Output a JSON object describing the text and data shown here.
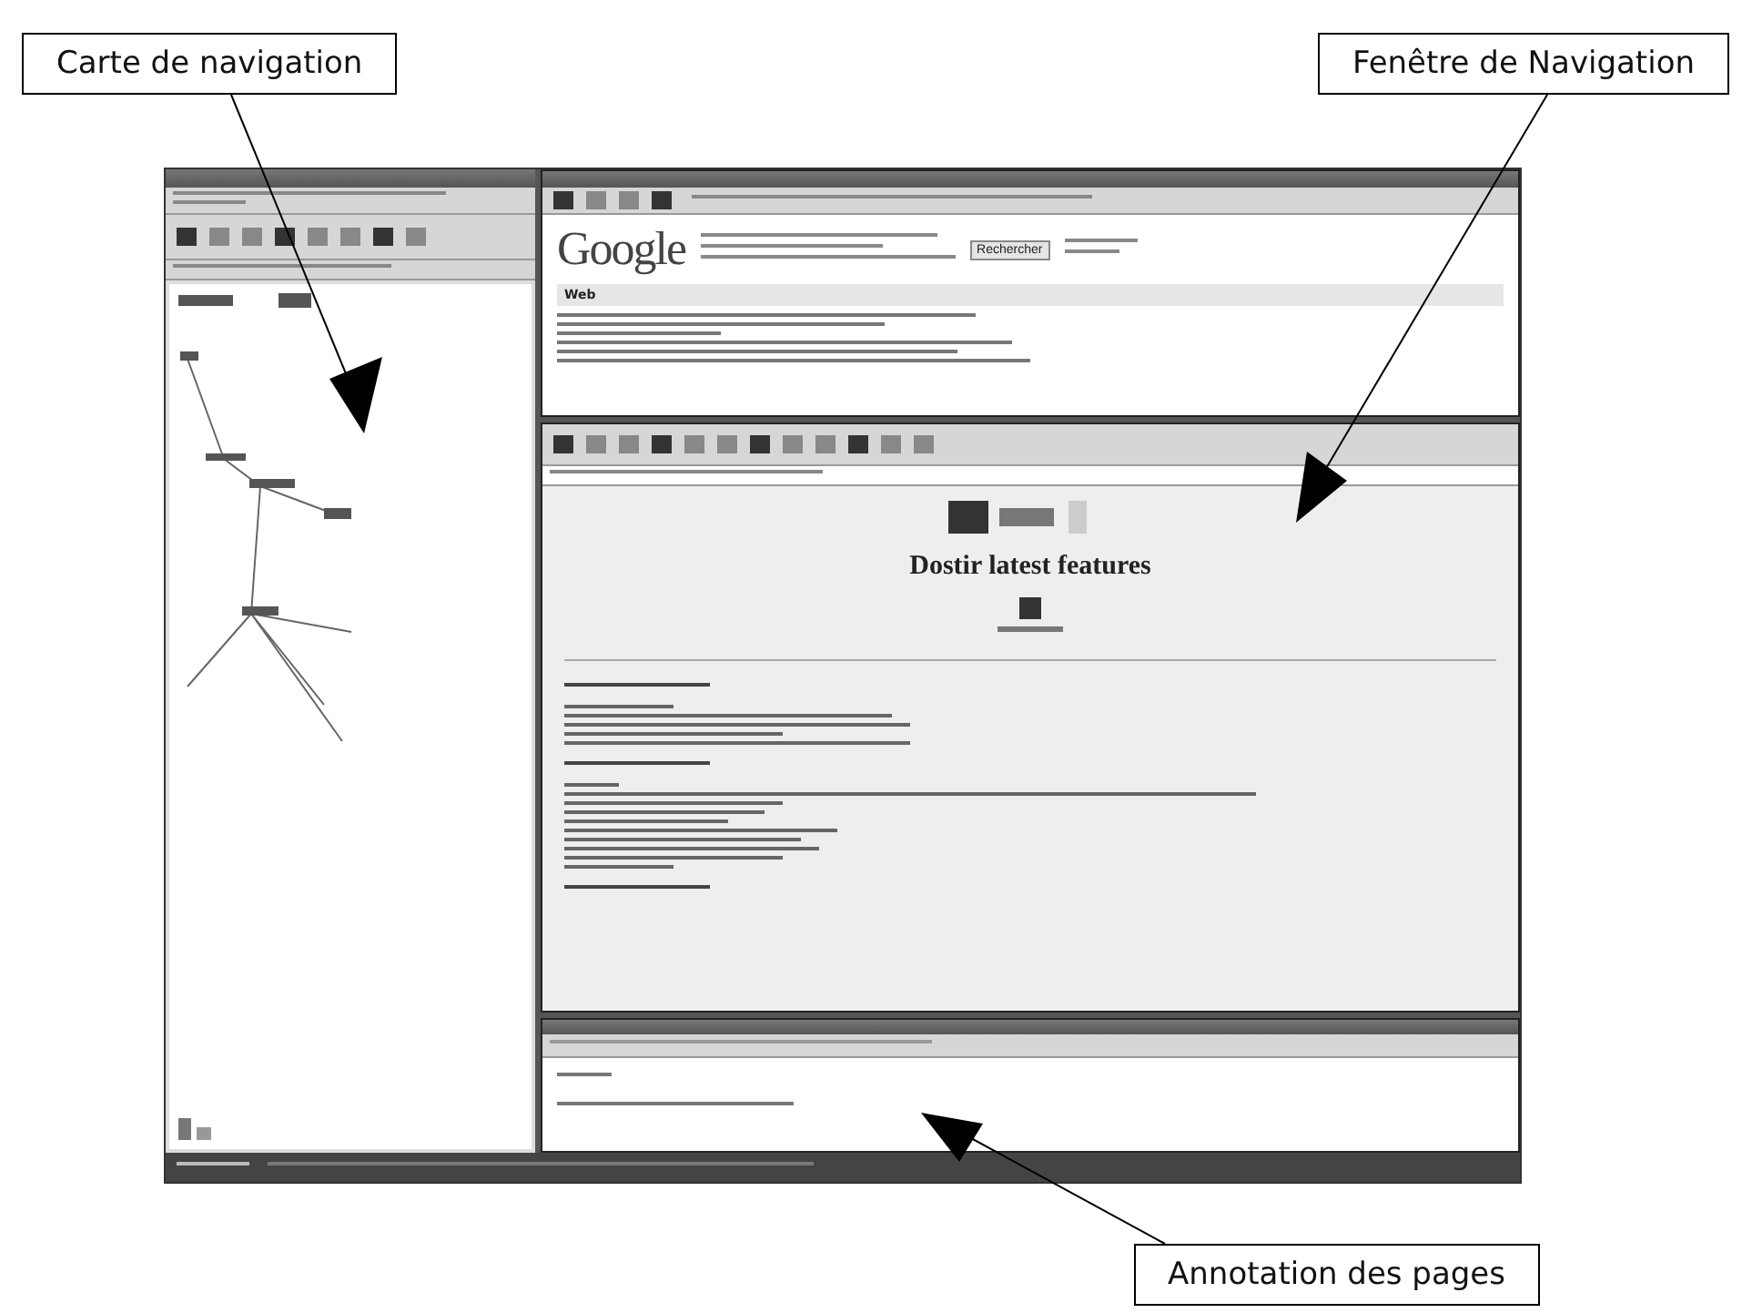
{
  "callouts": [
    {
      "label": "Carte de navigation"
    },
    {
      "label": "Fenêtre de Navigation"
    },
    {
      "label": "Annotation des pages"
    }
  ],
  "search_pane": {
    "logo": "Google",
    "button": "Rechercher",
    "section": "Web"
  },
  "page_pane": {
    "heading": "Dostir latest features"
  }
}
